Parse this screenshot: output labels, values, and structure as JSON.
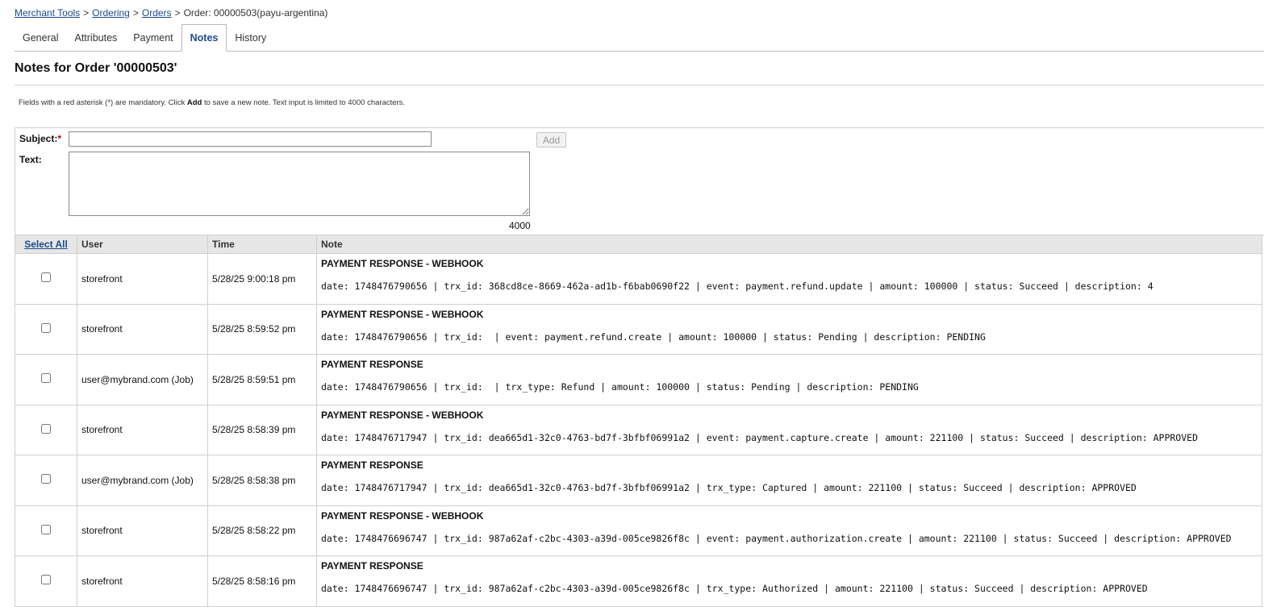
{
  "breadcrumb": {
    "items": [
      "Merchant Tools",
      "Ordering",
      "Orders"
    ],
    "current": "Order: 00000503(payu-argentina)",
    "separator": ">"
  },
  "tabs": [
    "General",
    "Attributes",
    "Payment",
    "Notes",
    "History"
  ],
  "active_tab": "Notes",
  "page_title": "Notes for Order '00000503'",
  "hint": {
    "before": "Fields with a red asterisk (*) are mandatory. Click ",
    "bold": "Add",
    "after": " to save a new note. Text input is limited to 4000 characters."
  },
  "form": {
    "subject_label": "Subject:",
    "required_mark": "*",
    "subject_value": "",
    "text_label": "Text:",
    "text_value": "",
    "add_label": "Add",
    "counter": "4000"
  },
  "table": {
    "headers": {
      "select_all": "Select All",
      "user": "User",
      "time": "Time",
      "note": "Note"
    },
    "rows": [
      {
        "user": "storefront",
        "time": "5/28/25 9:00:18 pm",
        "subject": "PAYMENT RESPONSE - WEBHOOK",
        "text": "date: 1748476790656 | trx_id: 368cd8ce-8669-462a-ad1b-f6bab0690f22 | event: payment.refund.update | amount: 100000 | status: Succeed | description: 4"
      },
      {
        "user": "storefront",
        "time": "5/28/25 8:59:52 pm",
        "subject": "PAYMENT RESPONSE - WEBHOOK",
        "text": "date: 1748476790656 | trx_id:  | event: payment.refund.create | amount: 100000 | status: Pending | description: PENDING"
      },
      {
        "user": "user@mybrand.com (Job)",
        "time": "5/28/25 8:59:51 pm",
        "subject": "PAYMENT RESPONSE",
        "text": "date: 1748476790656 | trx_id:  | trx_type: Refund | amount: 100000 | status: Pending | description: PENDING"
      },
      {
        "user": "storefront",
        "time": "5/28/25 8:58:39 pm",
        "subject": "PAYMENT RESPONSE - WEBHOOK",
        "text": "date: 1748476717947 | trx_id: dea665d1-32c0-4763-bd7f-3bfbf06991a2 | event: payment.capture.create | amount: 221100 | status: Succeed | description: APPROVED"
      },
      {
        "user": "user@mybrand.com (Job)",
        "time": "5/28/25 8:58:38 pm",
        "subject": "PAYMENT RESPONSE",
        "text": "date: 1748476717947 | trx_id: dea665d1-32c0-4763-bd7f-3bfbf06991a2 | trx_type: Captured | amount: 221100 | status: Succeed | description: APPROVED"
      },
      {
        "user": "storefront",
        "time": "5/28/25 8:58:22 pm",
        "subject": "PAYMENT RESPONSE - WEBHOOK",
        "text": "date: 1748476696747 | trx_id: 987a62af-c2bc-4303-a39d-005ce9826f8c | event: payment.authorization.create | amount: 221100 | status: Succeed | description: APPROVED"
      },
      {
        "user": "storefront",
        "time": "5/28/25 8:58:16 pm",
        "subject": "PAYMENT RESPONSE",
        "text": "date: 1748476696747 | trx_id: 987a62af-c2bc-4303-a39d-005ce9826f8c | trx_type: Authorized | amount: 221100 | status: Succeed | description: APPROVED"
      }
    ]
  },
  "colors": {
    "link": "#1a4a8c",
    "required": "#d40000",
    "header_bg": "#e6e6e6",
    "border": "#cfcfcf"
  }
}
